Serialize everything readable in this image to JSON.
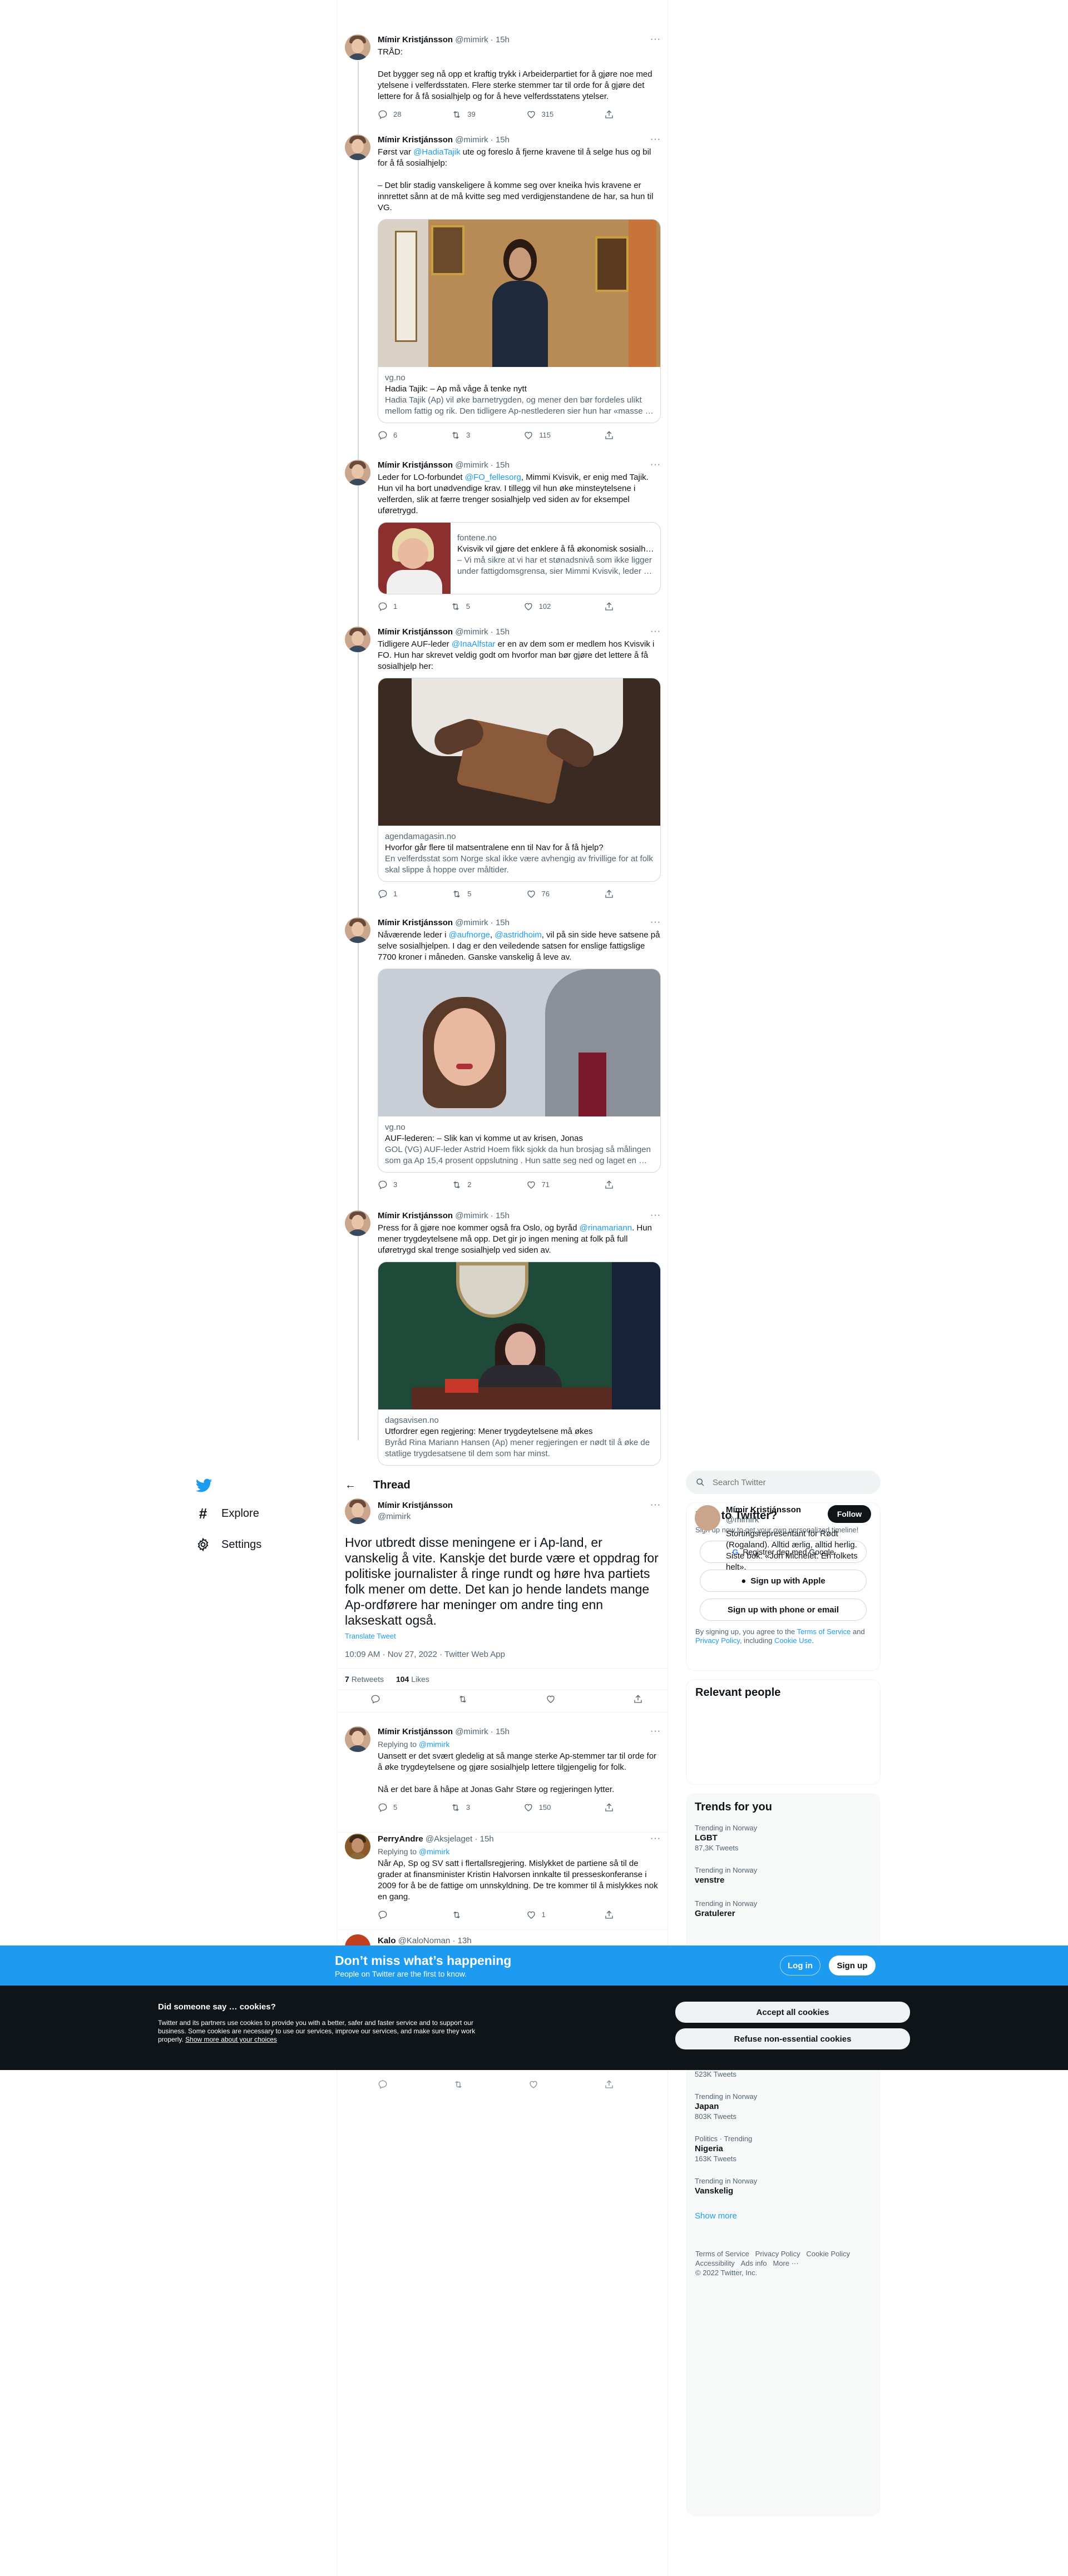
{
  "thread_tweets": [
    {
      "name": "Mímir Kristjánsson",
      "handle": "@mimirk",
      "time": "15h",
      "paras": [
        "TRÅD:",
        "Det bygger seg nå opp et kraftig trykk i Arbeiderpartiet for å gjøre noe med ytelsene i velferdsstaten. Flere sterke stemmer tar til orde for å gjøre det lettere for å få sosialhjelp og for å heve velferdsstatens ytelser."
      ],
      "replies": "28",
      "retweets": "39",
      "likes": "315"
    },
    {
      "name": "Mímir Kristjánsson",
      "handle": "@mimirk",
      "time": "15h",
      "paras_html": true,
      "p1_a": "Først var ",
      "p1_link": "@HadiaTajik",
      "p1_b": " ute og foreslo å fjerne kravene til å selge hus og bil for å få sosialhjelp:",
      "p2": "– Det blir stadig vanskeligere å komme seg over kneika hvis kravene er innrettet sånn at de må kvitte seg med verdigjenstandene de har, sa hun til VG.",
      "card": {
        "domain": "vg.no",
        "title": "Hadia Tajik: – Ap må våge å tenke nytt",
        "desc": "Hadia Tajik (Ap) vil øke barnetrygden, og mener den bør fordeles ulikt mellom fattig og rik. Den tidligere Ap-nestlederen sier hun har «masse …"
      },
      "replies": "6",
      "retweets": "3",
      "likes": "115"
    },
    {
      "name": "Mímir Kristjánsson",
      "handle": "@mimirk",
      "time": "15h",
      "p1_a": "Leder for LO-forbundet ",
      "p1_link": "@FO_fellesorg",
      "p1_b": ", Mimmi Kvisvik, er enig med Tajik. Hun vil ha bort unødvendige krav. I tillegg vil hun øke minsteytelsene i velferden, slik at færre trenger sosialhjelp ved siden av for eksempel uføretrygd.",
      "card": {
        "domain": "fontene.no",
        "title": "Kvisvik vil gjøre det enklere å få økonomisk sosialh…",
        "desc": "– Vi må sikre at vi har et stønadsnivå som ikke ligger under fattigdomsgrensa, sier Mimmi Kvisvik, leder …"
      },
      "replies": "1",
      "retweets": "5",
      "likes": "102"
    },
    {
      "name": "Mímir Kristjánsson",
      "handle": "@mimirk",
      "time": "15h",
      "p1_a": "Tidligere AUF-leder ",
      "p1_link": "@InaAlfstar",
      "p1_b": " er en av dem som er medlem hos Kvisvik i FO. Hun har skrevet veldig godt om hvorfor man bør gjøre det lettere å få sosialhjelp her:",
      "card": {
        "domain": "agendamagasin.no",
        "title": "Hvorfor går flere til matsentralene enn til Nav for å få hjelp?",
        "desc": "En velferdsstat som Norge skal ikke være avhengig av frivillige for at folk skal slippe å hoppe over måltider."
      },
      "replies": "1",
      "retweets": "5",
      "likes": "76"
    },
    {
      "name": "Mímir Kristjánsson",
      "handle": "@mimirk",
      "time": "15h",
      "p1_a": "Nåværende leder i ",
      "p1_link": "@aufnorge",
      "p1_mid": ", ",
      "p1_link2": "@astridhoim",
      "p1_b": ", vil på sin side heve satsene på selve sosialhjelpen. I dag er den veiledende satsen for enslige fattigslige 7700 kroner i måneden. Ganske vanskelig å leve av.",
      "card": {
        "domain": "vg.no",
        "title": "AUF-lederen: – Slik kan vi komme ut av krisen, Jonas",
        "desc": "GOL (VG) AUF-leder Astrid Hoem fikk sjokk da hun brosjag så målingen som ga Ap 15,4 prosent oppslutning . Hun satte seg ned og laget en …"
      },
      "replies": "3",
      "retweets": "2",
      "likes": "71"
    },
    {
      "name": "Mímir Kristjánsson",
      "handle": "@mimirk",
      "time": "15h",
      "p1_a": "Press for å gjøre noe kommer også fra Oslo, og byråd ",
      "p1_link": "@rinamariann",
      "p1_b": ". Hun mener trygdeytelsene må opp. Det gir jo ingen mening at folk på full uføretrygd skal trenge sosialhjelp ved siden av.",
      "card": {
        "domain": "dagsavisen.no",
        "title": "Utfordrer egen regjering: Mener trygdeytelsene må økes",
        "desc": "Byråd Rina Mariann Hansen (Ap) mener regjeringen er nødt til å øke de statlige trygdesatsene til dem som har minst."
      }
    }
  ],
  "nav": {
    "explore": "Explore",
    "settings": "Settings"
  },
  "thread_header": "Thread",
  "main": {
    "name": "Mímir Kristjánsson",
    "handle": "@mimirk",
    "text": "Hvor utbredt disse meningene er i Ap-land, er vanskelig å vite. Kanskje det burde være et oppdrag for politiske journalister å ringe rundt og høre hva partiets folk mener om dette. Det kan jo hende landets mange Ap-ordførere har meninger om andre ting enn lakseskatt også.",
    "translate": "Translate Tweet",
    "timestamp": "10:09 AM · Nov 27, 2022 · Twitter Web App",
    "retweets_count": "7",
    "retweets_label": "Retweets",
    "likes_count": "104",
    "likes_label": "Likes"
  },
  "replies": [
    {
      "name": "Mímir Kristjánsson",
      "handle": "@mimirk",
      "time": "15h",
      "replying": "Replying to",
      "replying_to": "@mimirk",
      "p1": "Uansett er det svært gledelig at så mange sterke Ap-stemmer tar til orde for å øke trygdeytelsene og gjøre sosialhjelp lettere tilgjengelig for folk.",
      "p2": "Nå er det bare å håpe at Jonas Gahr Støre og regjeringen lytter.",
      "replies": "5",
      "retweets": "3",
      "likes": "150"
    },
    {
      "name": "PerryAndre",
      "handle": "@Aksjelaget",
      "time": "15h",
      "replying": "Replying to",
      "replying_to": "@mimirk",
      "p1": "Når Ap, Sp og SV satt i flertallsregjering. Mislykket de partiene så til de grader at finansminister Kristin Halvorsen innkalte til presseskonferanse i 2009 for å be de fattige om unnskyldning. De tre kommer til å mislykkes nok en gang.",
      "replies": "",
      "retweets": "",
      "likes": "1"
    },
    {
      "name": "Kalo",
      "handle": "@KaloNoman",
      "time": "13h"
    }
  ],
  "search": {
    "placeholder": "Search Twitter"
  },
  "new_to_twitter": {
    "title": "New to Twitter?",
    "subtitle": "Sign up now to get your own personalized timeline!",
    "google": "Registrer deg med Google",
    "apple": "Sign up with Apple",
    "phone": "Sign up with phone or email",
    "terms_a": "By signing up, you agree to the ",
    "terms_link1": "Terms of Service",
    "terms_b": " and ",
    "terms_link2": "Privacy Policy",
    "terms_c": ", including ",
    "terms_link3": "Cookie Use",
    "terms_d": "."
  },
  "relevant": {
    "title": "Relevant people",
    "name": "Mímir Kristjánsson",
    "handle": "@mimirk",
    "follow": "Follow",
    "bio": "Stortingsrepresentant for Rødt (Rogaland). Alltid ærlig, alltid herlig. Siste bok: «Jon Michelet. En folkets helt»."
  },
  "trends": {
    "title": "Trends for you",
    "items": [
      {
        "ctx": "Trending in Norway",
        "name": "LGBT",
        "count": "87,3K Tweets"
      },
      {
        "ctx": "Trending in Norway",
        "name": "venstre",
        "count": ""
      },
      {
        "ctx": "Trending in Norway",
        "name": "Gratulerer",
        "count": ""
      }
    ],
    "lower": [
      {
        "ctx": "",
        "name": "",
        "count": "523K Tweets"
      },
      {
        "ctx": "Trending in Norway",
        "name": "Japan",
        "count": "803K Tweets"
      },
      {
        "ctx": "Politics · Trending",
        "name": "Nigeria",
        "count": "163K Tweets"
      },
      {
        "ctx": "Trending in Norway",
        "name": "Vanskelig",
        "count": ""
      }
    ],
    "show_more": "Show more"
  },
  "footer": {
    "l1": "Terms of Service",
    "l2": "Privacy Policy",
    "l3": "Cookie Policy",
    "l4": "Accessibility",
    "l5": "Ads info",
    "l6": "More ···",
    "copy": "© 2022 Twitter, Inc."
  },
  "banner": {
    "title": "Don’t miss what’s happening",
    "subtitle": "People on Twitter are the first to know.",
    "login": "Log in",
    "signup": "Sign up"
  },
  "cookie": {
    "title": "Did someone say … cookies?",
    "text": "Twitter and its partners use cookies to provide you with a better, safer and faster service and to support our business. Some cookies are necessary to use our services, improve our services, and make sure they work properly.",
    "link": "Show more about your choices",
    "accept": "Accept all cookies",
    "refuse": "Refuse non-essential cookies"
  },
  "colors": {
    "accent": "#1d9bf0",
    "dark": "#0f1419",
    "muted": "#536471"
  }
}
